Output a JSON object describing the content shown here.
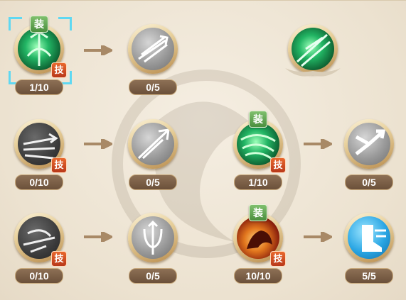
{
  "badges": {
    "equipped": "装",
    "skill": "技"
  },
  "colors": {
    "arrow": "#a88966",
    "selection": "#5fd8f2",
    "counter_bg": "#6b503a"
  },
  "rows": [
    {
      "nodes": [
        {
          "count": "1/10",
          "icon": "green-arrow-rain-icon",
          "equipped": true,
          "skill": true,
          "selected": true
        },
        {
          "count": "0/5",
          "icon": "triple-arrow-icon",
          "equipped": false,
          "skill": false,
          "selected": false
        },
        {
          "icon": "green-wind-burst-icon",
          "equipped": false,
          "skill": false,
          "locked_preview": true
        }
      ]
    },
    {
      "nodes": [
        {
          "count": "0/10",
          "icon": "multi-arrow-volley-icon",
          "equipped": false,
          "skill": true
        },
        {
          "count": "0/5",
          "icon": "piercing-arrow-icon",
          "equipped": false,
          "skill": false
        },
        {
          "count": "1/10",
          "icon": "green-storm-icon",
          "equipped": true,
          "skill": true
        },
        {
          "count": "0/5",
          "icon": "split-arrow-icon",
          "equipped": false,
          "skill": false
        }
      ]
    },
    {
      "nodes": [
        {
          "count": "0/10",
          "icon": "archer-shot-icon",
          "equipped": false,
          "skill": true
        },
        {
          "count": "0/5",
          "icon": "trident-arrow-icon",
          "equipped": false,
          "skill": false
        },
        {
          "count": "10/10",
          "icon": "fire-beast-icon",
          "equipped": true,
          "skill": true
        },
        {
          "count": "5/5",
          "icon": "swift-boot-icon",
          "equipped": false,
          "skill": false
        }
      ]
    }
  ]
}
